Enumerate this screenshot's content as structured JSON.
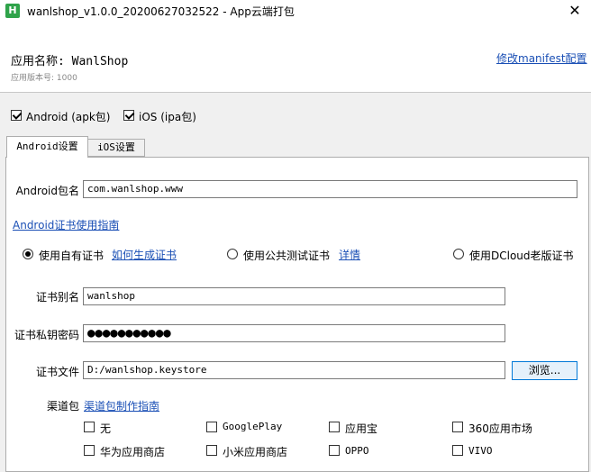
{
  "window": {
    "title": "wanlshop_v1.0.0_20200627032522 - App云端打包",
    "icon_label": "H",
    "close_glyph": "✕"
  },
  "header": {
    "app_name": "应用名称: WanlShop",
    "app_version": "应用版本号: 1000",
    "manifest_link": "修改manifest配置"
  },
  "platforms": [
    {
      "label": "Android (apk包)",
      "checked": true
    },
    {
      "label": "iOS (ipa包)",
      "checked": true
    }
  ],
  "tabs": [
    {
      "label": "Android设置",
      "active": true
    },
    {
      "label": "iOS设置",
      "active": false
    }
  ],
  "android": {
    "package_label": "Android包名",
    "package_value": "com.wanlshop.www",
    "cert_guide_link": "Android证书使用指南",
    "cert_options": [
      {
        "label": "使用自有证书",
        "selected": true,
        "link": "如何生成证书"
      },
      {
        "label": "使用公共测试证书",
        "selected": false,
        "link": "详情"
      },
      {
        "label": "使用DCloud老版证书",
        "selected": false,
        "link": ""
      }
    ],
    "alias_label": "证书别名",
    "alias_value": "wanlshop",
    "password_label": "证书私钥密码",
    "password_value": "●●●●●●●●●●●",
    "file_label": "证书文件",
    "file_value": "D:/wanlshop.keystore",
    "browse_label": "浏览...",
    "channel_label": "渠道包",
    "channel_guide_link": "渠道包制作指南",
    "channels": [
      {
        "label": "无",
        "checked": false
      },
      {
        "label": "GooglePlay",
        "checked": false
      },
      {
        "label": "应用宝",
        "checked": false
      },
      {
        "label": "360应用市场",
        "checked": false
      },
      {
        "label": "华为应用商店",
        "checked": false
      },
      {
        "label": "小米应用商店",
        "checked": false
      },
      {
        "label": "OPPO",
        "checked": false
      },
      {
        "label": "VIVO",
        "checked": false
      }
    ]
  }
}
